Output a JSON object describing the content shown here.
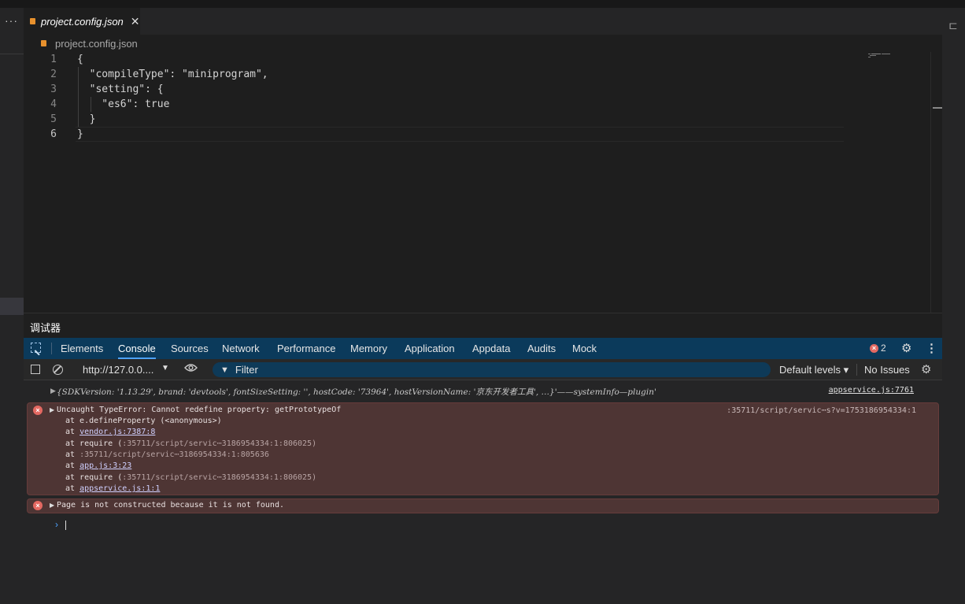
{
  "editor": {
    "tab": {
      "name": "project.config.json",
      "close": "✕"
    },
    "breadcrumb": "project.config.json",
    "lines": [
      {
        "n": "1",
        "text": "{"
      },
      {
        "n": "2",
        "text": "  \"compileType\": \"miniprogram\","
      },
      {
        "n": "3",
        "text": "  \"setting\": {"
      },
      {
        "n": "4",
        "text": "    \"es6\": true"
      },
      {
        "n": "5",
        "text": "  }"
      },
      {
        "n": "6",
        "text": "}"
      }
    ]
  },
  "debugger": {
    "title": "调试器",
    "tabs": [
      "Elements",
      "Console",
      "Sources",
      "Network",
      "Performance",
      "Memory",
      "Application",
      "Appdata",
      "Audits",
      "Mock"
    ],
    "active_tab": "Console",
    "error_count": "2",
    "more": "⋮"
  },
  "toolbar": {
    "context": "http://127.0.0....",
    "filter_placeholder": "Filter",
    "levels": "Default levels ▾",
    "issues": "No Issues"
  },
  "console": {
    "info": {
      "object_text": "{SDKVersion: '1.13.29', brand: 'devtools', fontSizeSetting: '', hostCode: '73964', hostVersionName: '京东开发者工具', …}'——systemInfo—plugin'",
      "source": "appservice.js:7761"
    },
    "error1": {
      "message": "Uncaught TypeError: Cannot redefine property: getPrototypeOf",
      "source": ":35711/script/servic⋯s?v=1753186954334:1",
      "stack": [
        {
          "prefix": "at e.defineProperty (<anonymous>)",
          "link": "",
          "suffix": ""
        },
        {
          "prefix": "at ",
          "link": "vendor.js:7387:8",
          "suffix": ""
        },
        {
          "prefix": "at require (",
          "link": "",
          "suffix": ":35711/script/servic⋯3186954334:1:806025)"
        },
        {
          "prefix": "at ",
          "link": "",
          "suffix": ":35711/script/servic⋯3186954334:1:805636"
        },
        {
          "prefix": "at ",
          "link": "app.js:3:23",
          "suffix": ""
        },
        {
          "prefix": "at require (",
          "link": "",
          "suffix": ":35711/script/servic⋯3186954334:1:806025)"
        },
        {
          "prefix": "at ",
          "link": "appservice.js:1:1",
          "suffix": ""
        }
      ]
    },
    "error2": {
      "message": "Page is not constructed because it is not found."
    },
    "prompt": "›"
  }
}
